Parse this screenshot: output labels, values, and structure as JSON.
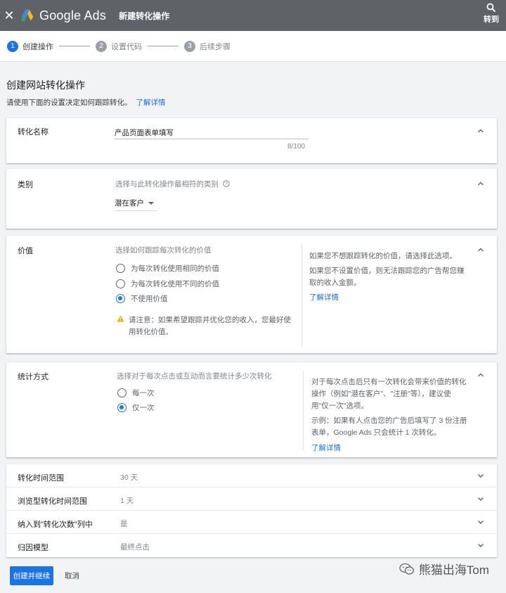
{
  "topbar": {
    "close": "✕",
    "brand": "Google Ads",
    "title": "新建转化操作",
    "goto": "转到"
  },
  "stepper": {
    "steps": [
      {
        "num": "1",
        "label": "创建操作"
      },
      {
        "num": "2",
        "label": "设置代码"
      },
      {
        "num": "3",
        "label": "后续步骤"
      }
    ]
  },
  "page": {
    "heading": "创建网站转化操作",
    "subtitle": "请使用下面的设置决定如何跟踪转化。",
    "learn_more": "了解详情"
  },
  "name_card": {
    "label": "转化名称",
    "value": "产品页面表单填写",
    "counter": "8/100"
  },
  "category_card": {
    "label": "类别",
    "hint": "选择与此转化操作最相符的类别",
    "selected": "潜在客户"
  },
  "value_card": {
    "label": "价值",
    "hint": "选择如何跟踪每次转化的价值",
    "options": [
      "为每次转化使用相同的价值",
      "为每次转化使用不同的价值",
      "不使用价值"
    ],
    "warning_line1": "请注意：如果希望跟踪并优化您的收入，您最好使",
    "warning_line2": "用转化价值。",
    "side_p1": "如果您不想跟踪转化的价值，请选择此选项。",
    "side_p2_line1": "如果您不设置价值，则无法跟踪您的广告帮您赚",
    "side_p2_line2": "取的收入金额。",
    "learn_more": "了解详情"
  },
  "count_card": {
    "label": "统计方式",
    "hint": "选择对于每次点击或互动而言要统计多少次转化",
    "options": [
      "每一次",
      "仅一次"
    ],
    "side_p1_line1": "对于每次点击后只有一次转化会带来价值的转化",
    "side_p1_line2": "操作（例如\"潜在客户\"、\"注册\"等），建议使",
    "side_p1_line3": "用\"仅一次\"选项。",
    "side_p2_line1": "示例：如果有人点击您的广告后填写了 3 份注册",
    "side_p2_line2": "表单，Google Ads 只会统计 1 次转化。",
    "learn_more": "了解详情"
  },
  "settings": [
    {
      "label": "转化时间范围",
      "value": "30 天"
    },
    {
      "label": "浏览型转化时间范围",
      "value": "1 天"
    },
    {
      "label": "纳入到\"转化次数\"列中",
      "value": "是"
    },
    {
      "label": "归因模型",
      "value": "最终点击"
    }
  ],
  "actions": {
    "primary": "创建并继续",
    "cancel": "取消"
  },
  "watermark": "熊猫出海Tom",
  "colors": {
    "accent": "#1a73e8",
    "topbar": "#5f6368",
    "warning": "#f9ab00"
  }
}
